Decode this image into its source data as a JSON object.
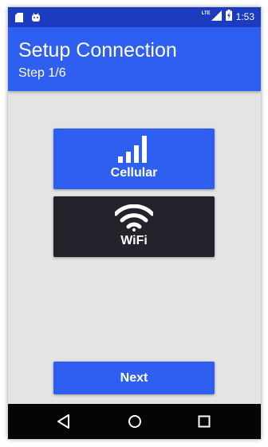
{
  "status_bar": {
    "time": "1:53",
    "network_label": "LTE",
    "icons": [
      "sd-card-icon",
      "android-icon",
      "signal-icon",
      "battery-charging-icon"
    ]
  },
  "app_bar": {
    "title": "Setup Connection",
    "subtitle": "Step 1/6"
  },
  "options": {
    "cellular": {
      "label": "Cellular",
      "icon": "cellular-signal-icon",
      "color": "#2e5ff0"
    },
    "wifi": {
      "label": "WiFi",
      "icon": "wifi-icon",
      "color": "#24232b"
    }
  },
  "footer": {
    "next_label": "Next"
  },
  "nav_bar": {
    "buttons": [
      "back-icon",
      "home-icon",
      "recents-icon"
    ]
  },
  "colors": {
    "accent": "#2e5ff0",
    "status_bar": "#1c3cc0",
    "background": "#e4e4e4",
    "dark_button": "#24232b"
  }
}
